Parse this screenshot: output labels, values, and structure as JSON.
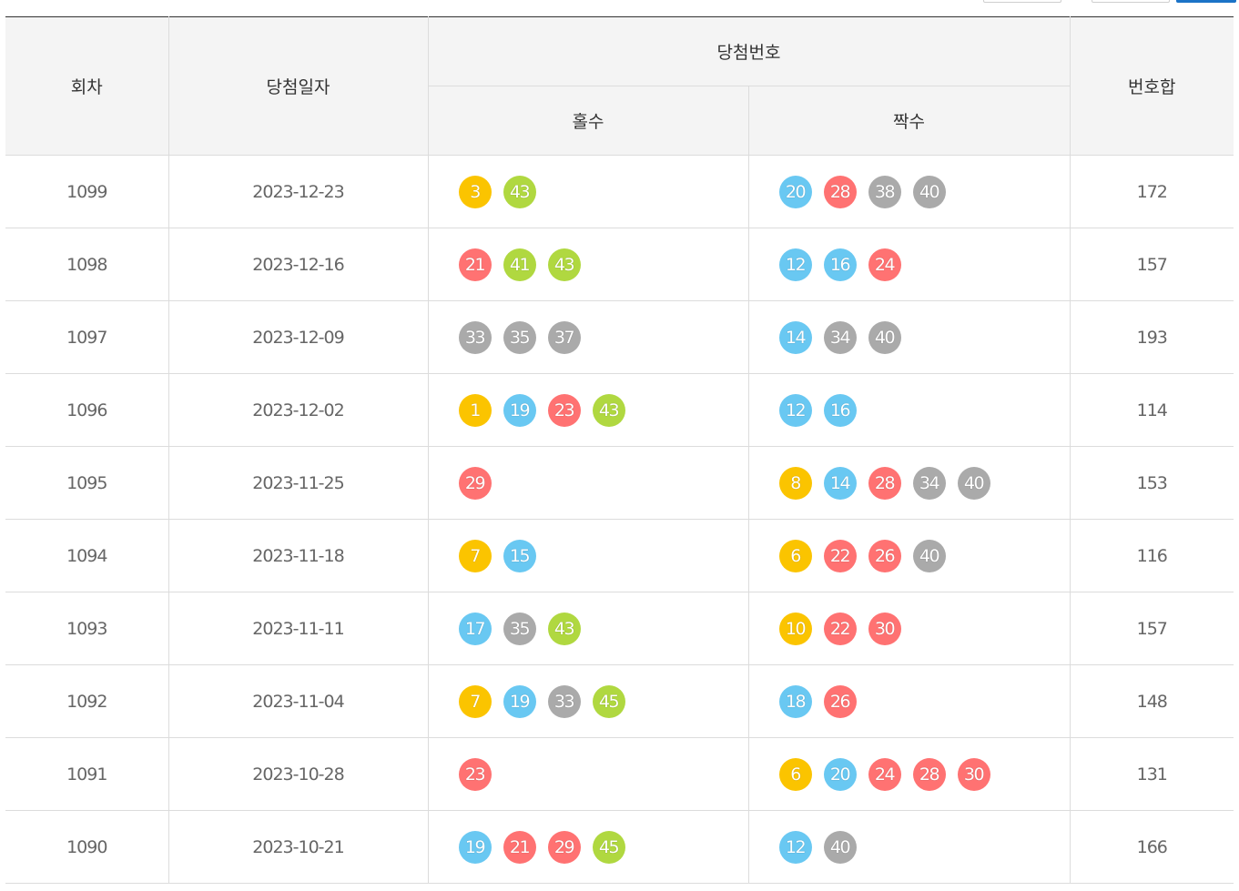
{
  "headers": {
    "round": "회차",
    "date": "당첨일자",
    "winning_numbers": "당첨번호",
    "odd": "홀수",
    "even": "짝수",
    "sum": "번호합"
  },
  "colors": {
    "yellow": "#fbc400",
    "blue": "#69c8f2",
    "red": "#ff7272",
    "gray": "#aaaaaa",
    "green": "#b0d840"
  },
  "rows": [
    {
      "round": "1099",
      "date": "2023-12-23",
      "odd": [
        "3",
        "43"
      ],
      "even": [
        "20",
        "28",
        "38",
        "40"
      ],
      "sum": "172"
    },
    {
      "round": "1098",
      "date": "2023-12-16",
      "odd": [
        "21",
        "41",
        "43"
      ],
      "even": [
        "12",
        "16",
        "24"
      ],
      "sum": "157"
    },
    {
      "round": "1097",
      "date": "2023-12-09",
      "odd": [
        "33",
        "35",
        "37"
      ],
      "even": [
        "14",
        "34",
        "40"
      ],
      "sum": "193"
    },
    {
      "round": "1096",
      "date": "2023-12-02",
      "odd": [
        "1",
        "19",
        "23",
        "43"
      ],
      "even": [
        "12",
        "16"
      ],
      "sum": "114"
    },
    {
      "round": "1095",
      "date": "2023-11-25",
      "odd": [
        "29"
      ],
      "even": [
        "8",
        "14",
        "28",
        "34",
        "40"
      ],
      "sum": "153"
    },
    {
      "round": "1094",
      "date": "2023-11-18",
      "odd": [
        "7",
        "15"
      ],
      "even": [
        "6",
        "22",
        "26",
        "40"
      ],
      "sum": "116"
    },
    {
      "round": "1093",
      "date": "2023-11-11",
      "odd": [
        "17",
        "35",
        "43"
      ],
      "even": [
        "10",
        "22",
        "30"
      ],
      "sum": "157"
    },
    {
      "round": "1092",
      "date": "2023-11-04",
      "odd": [
        "7",
        "19",
        "33",
        "45"
      ],
      "even": [
        "18",
        "26"
      ],
      "sum": "148"
    },
    {
      "round": "1091",
      "date": "2023-10-28",
      "odd": [
        "23"
      ],
      "even": [
        "6",
        "20",
        "24",
        "28",
        "30"
      ],
      "sum": "131"
    },
    {
      "round": "1090",
      "date": "2023-10-21",
      "odd": [
        "19",
        "21",
        "29",
        "45"
      ],
      "even": [
        "12",
        "40"
      ],
      "sum": "166"
    }
  ]
}
